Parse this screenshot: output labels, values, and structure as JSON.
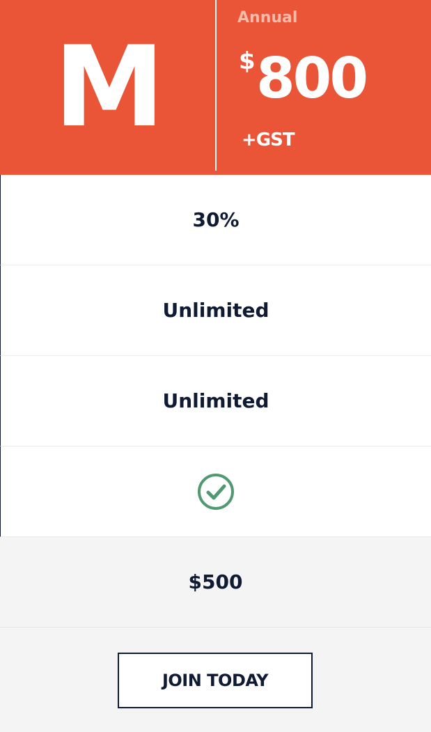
{
  "plan": {
    "tier_letter": "M",
    "period": "Annual",
    "currency_symbol": "$",
    "price": "800",
    "tax_note": "+GST"
  },
  "features": {
    "row_1": "30%",
    "row_2": "Unlimited",
    "row_3": "Unlimited",
    "row_4_icon": "check-circle-icon",
    "row_5": "$500"
  },
  "cta": {
    "label": "JOIN TODAY"
  },
  "colors": {
    "header_bg": "#e95536",
    "period_text": "#f7b9a8",
    "text_dark": "#0f1a33",
    "check_green": "#4f9a72",
    "shaded_bg": "#f4f4f4"
  }
}
